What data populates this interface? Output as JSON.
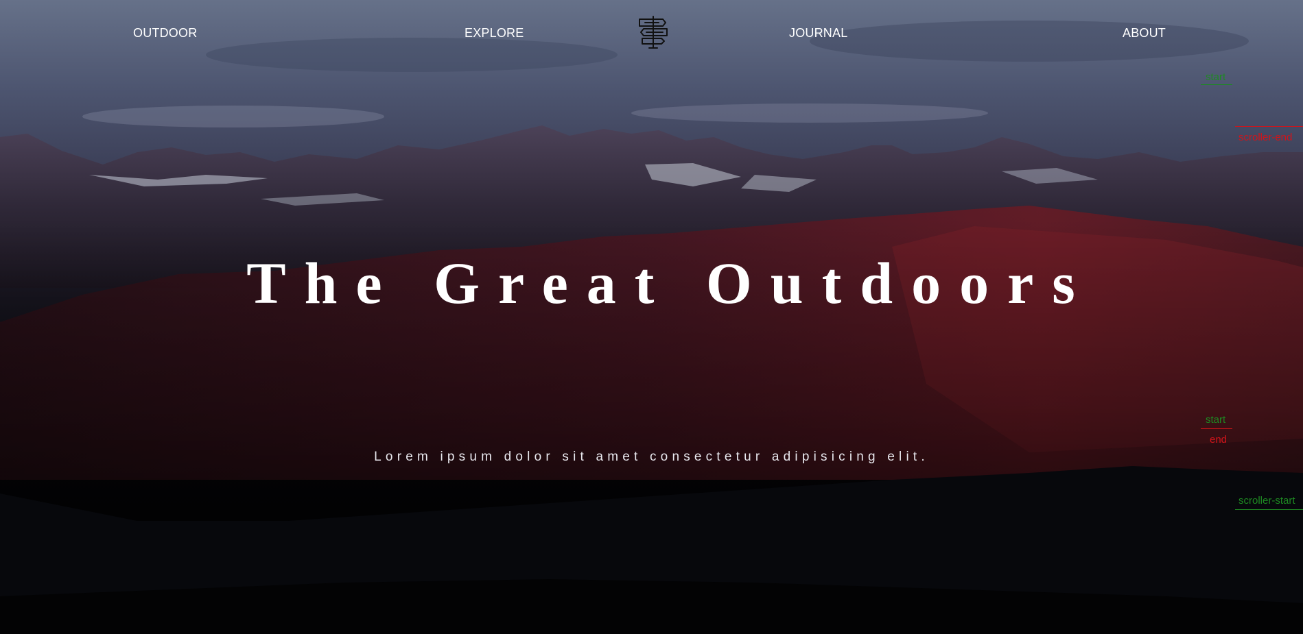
{
  "nav": {
    "items": [
      {
        "label": "OUTDOOR"
      },
      {
        "label": "EXPLORE"
      },
      {
        "label": "JOURNAL"
      },
      {
        "label": "ABOUT"
      }
    ],
    "logo_icon": "signpost-icon"
  },
  "hero": {
    "title": "The Great Outdoors",
    "subtitle": "Lorem ipsum dolor sit amet consectetur adipisicing elit."
  },
  "markers": {
    "start_top": "start",
    "scroller_end": "scroller-end",
    "start": "start",
    "end": "end",
    "scroller_start": "scroller-start"
  },
  "colors": {
    "marker_start": "#1e8a22",
    "marker_end": "#d0141a",
    "text": "#ffffff"
  }
}
